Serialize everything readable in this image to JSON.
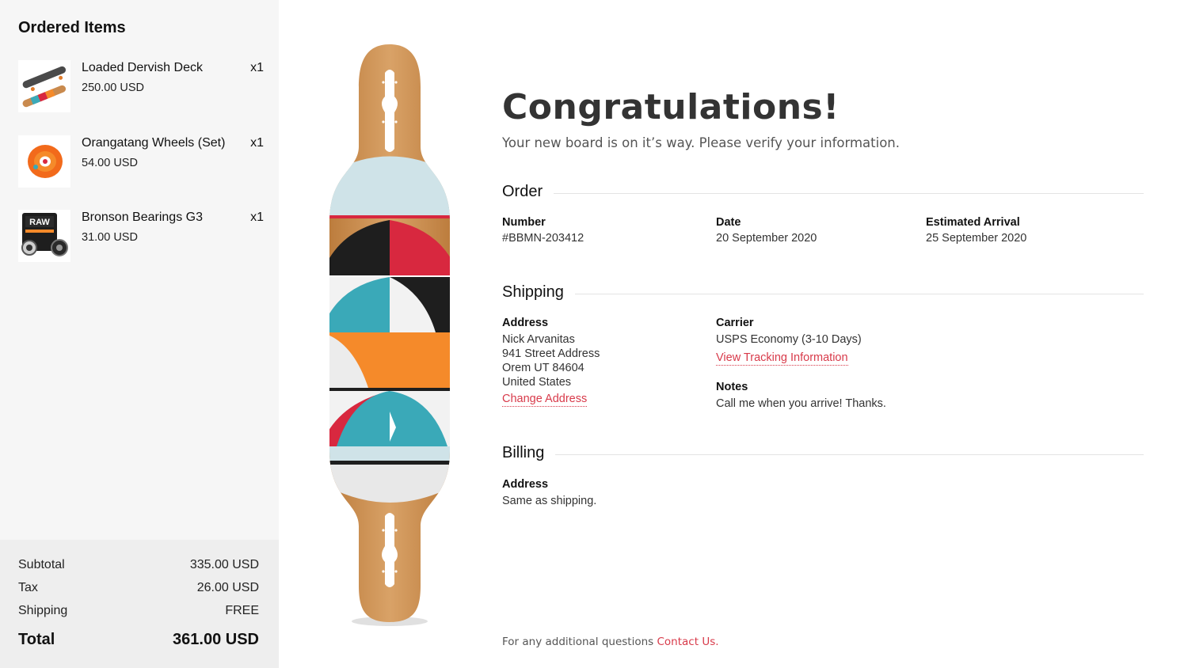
{
  "sidebar": {
    "title": "Ordered Items",
    "items": [
      {
        "name": "Loaded Dervish Deck",
        "price": "250.00 USD",
        "qty": "x1",
        "thumb_icon": "longboard-thumbnail"
      },
      {
        "name": "Orangatang Wheels (Set)",
        "price": "54.00 USD",
        "qty": "x1",
        "thumb_icon": "wheel-thumbnail"
      },
      {
        "name": "Bronson Bearings G3",
        "price": "31.00 USD",
        "qty": "x1",
        "thumb_icon": "bearings-thumbnail",
        "thumb_text": "RAW"
      }
    ],
    "totals": {
      "subtotal_label": "Subtotal",
      "subtotal_value": "335.00 USD",
      "tax_label": "Tax",
      "tax_value": "26.00 USD",
      "shipping_label": "Shipping",
      "shipping_value": "FREE",
      "total_label": "Total",
      "total_value": "361.00 USD"
    }
  },
  "main": {
    "heading": "Congratulations!",
    "subtitle": "Your new board is on it’s way. Please verify your information.",
    "order": {
      "title": "Order",
      "number_label": "Number",
      "number_value": "#BBMN-203412",
      "date_label": "Date",
      "date_value": "20 September 2020",
      "arrival_label": "Estimated Arrival",
      "arrival_value": "25 September 2020"
    },
    "shipping": {
      "title": "Shipping",
      "address_label": "Address",
      "address_lines": [
        "Nick Arvanitas",
        "941 Street Address",
        "Orem UT 84604",
        "United States"
      ],
      "change_address": "Change Address",
      "carrier_label": "Carrier",
      "carrier_value": "USPS Economy (3-10 Days)",
      "tracking_link": "View Tracking Information",
      "notes_label": "Notes",
      "notes_value": "Call me when you arrive! Thanks."
    },
    "billing": {
      "title": "Billing",
      "address_label": "Address",
      "address_value": "Same as shipping."
    },
    "footer": {
      "text": "For any additional questions",
      "contact_link": "Contact Us."
    }
  },
  "colors": {
    "accent": "#d83a4a",
    "sidebar_bg": "#f6f6f6",
    "totals_bg": "#eeeeee",
    "board_wood": "#c98a4e",
    "board_blue": "#3aa9b8",
    "board_red": "#d8283f",
    "board_orange": "#f58a2a"
  }
}
